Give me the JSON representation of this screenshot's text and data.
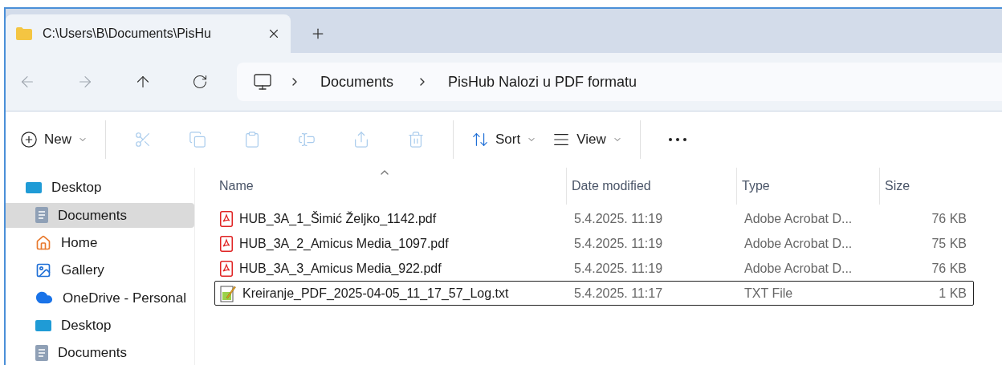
{
  "tab": {
    "title": "C:\\Users\\B\\Documents\\PisHu",
    "selected": true
  },
  "address": {
    "crumbs": [
      "Documents",
      "PisHub Nalozi u PDF formatu"
    ]
  },
  "toolbar": [
    {
      "kind": "new",
      "label": "New",
      "disabled": false
    },
    {
      "kind": "cut",
      "disabled": true
    },
    {
      "kind": "copy",
      "disabled": true
    },
    {
      "kind": "paste",
      "disabled": true
    },
    {
      "kind": "rename",
      "disabled": true
    },
    {
      "kind": "share",
      "disabled": true
    },
    {
      "kind": "delete",
      "disabled": true
    },
    {
      "kind": "sort",
      "label": "Sort",
      "disabled": false
    },
    {
      "kind": "view",
      "label": "View",
      "disabled": false
    },
    {
      "kind": "more"
    }
  ],
  "sidebar": {
    "items": [
      {
        "kind": "desktop",
        "label": "Desktop",
        "selected": false,
        "indent": false
      },
      {
        "kind": "documents",
        "label": "Documents",
        "selected": true,
        "indent": true
      },
      {
        "kind": "home",
        "label": "Home",
        "selected": false,
        "indent": true
      },
      {
        "kind": "gallery",
        "label": "Gallery",
        "selected": false,
        "indent": true
      },
      {
        "kind": "onedrive",
        "label": "OneDrive - Personal",
        "selected": false,
        "indent": true
      },
      {
        "kind": "desktop",
        "label": "Desktop",
        "selected": false,
        "indent": true
      },
      {
        "kind": "documents",
        "label": "Documents",
        "selected": false,
        "indent": true
      }
    ]
  },
  "table": {
    "columns": [
      {
        "label": "Name",
        "sorted": true
      },
      {
        "label": "Date modified",
        "sorted": false
      },
      {
        "label": "Type",
        "sorted": false
      },
      {
        "label": "Size",
        "sorted": false
      }
    ],
    "rows": [
      {
        "kind": "pdf",
        "name": "HUB_3A_1_Šimić Željko_1142.pdf",
        "date": "5.4.2025. 11:19",
        "type": "Adobe Acrobat D...",
        "size": "76 KB",
        "focused": false
      },
      {
        "kind": "pdf",
        "name": "HUB_3A_2_Amicus Media_1097.pdf",
        "date": "5.4.2025. 11:19",
        "type": "Adobe Acrobat D...",
        "size": "75 KB",
        "focused": false
      },
      {
        "kind": "pdf",
        "name": "HUB_3A_3_Amicus Media_922.pdf",
        "date": "5.4.2025. 11:19",
        "type": "Adobe Acrobat D...",
        "size": "76 KB",
        "focused": false
      },
      {
        "kind": "txt",
        "name": "Kreiranje_PDF_2025-04-05_11_17_57_Log.txt",
        "date": "5.4.2025. 11:17",
        "type": "TXT File",
        "size": "1 KB",
        "focused": true
      }
    ]
  }
}
